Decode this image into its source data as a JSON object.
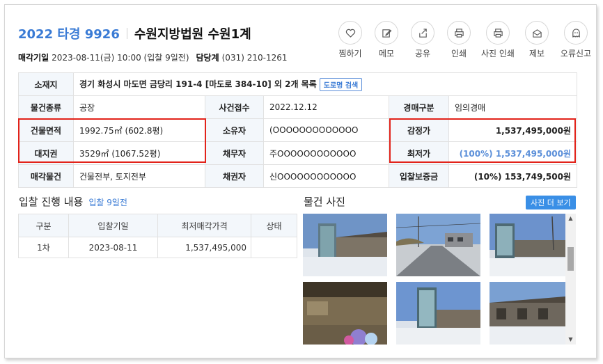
{
  "header": {
    "case_number": "2022 타경 9926",
    "court": "수원지방법원 수원1계",
    "sale_date_label": "매각기일",
    "sale_date": "2023-08-11(금) 10:00 (입찰 9일전)",
    "dept_label": "담당계",
    "dept_phone": "(031) 210-1261"
  },
  "actions": [
    {
      "label": "찜하기",
      "icon": "heart-icon"
    },
    {
      "label": "메모",
      "icon": "edit-icon"
    },
    {
      "label": "공유",
      "icon": "share-icon"
    },
    {
      "label": "인쇄",
      "icon": "printer-icon"
    },
    {
      "label": "사진 인쇄",
      "icon": "photo-print-icon"
    },
    {
      "label": "제보",
      "icon": "mail-icon"
    },
    {
      "label": "오류신고",
      "icon": "ghost-icon"
    }
  ],
  "info": {
    "address_label": "소재지",
    "address": "경기 화성시 마도면 금당리 191-4 [마도로 384-10] 외 2개 목록",
    "road_search": "도로명 검색",
    "type_label": "물건종류",
    "type": "공장",
    "received_label": "사건접수",
    "received": "2022.12.12",
    "auction_type_label": "경매구분",
    "auction_type": "임의경매",
    "building_area_label": "건물면적",
    "building_area": "1992.75㎡ (602.8평)",
    "owner_label": "소유자",
    "owner": "(OOOOOOOOOOOOO",
    "appraisal_label": "감정가",
    "appraisal": "1,537,495,000원",
    "land_right_label": "대지권",
    "land_right": "3529㎡ (1067.52평)",
    "debtor_label": "채무자",
    "debtor": "주OOOOOOOOOOOO",
    "min_price_label": "최저가",
    "min_price": "(100%) 1,537,495,000원",
    "sale_items_label": "매각물건",
    "sale_items": "건물전부, 토지전부",
    "creditor_label": "채권자",
    "creditor": "신OOOOOOOOOOOO",
    "deposit_label": "입찰보증금",
    "deposit": "(10%) 153,749,500원"
  },
  "bids": {
    "title": "입찰 진행 내용",
    "sub": "입찰 9일전",
    "headers": [
      "구분",
      "입찰기일",
      "최저매각가격",
      "상태"
    ],
    "rows": [
      [
        "1차",
        "2023-08-11",
        "1,537,495,000",
        ""
      ]
    ]
  },
  "photos": {
    "title": "물건 사진",
    "more_button": "사진 더 보기"
  },
  "colors": {
    "accent_blue": "#3a7bd5",
    "highlight_red": "#e2231a",
    "header_bg": "#f3f7fb"
  }
}
